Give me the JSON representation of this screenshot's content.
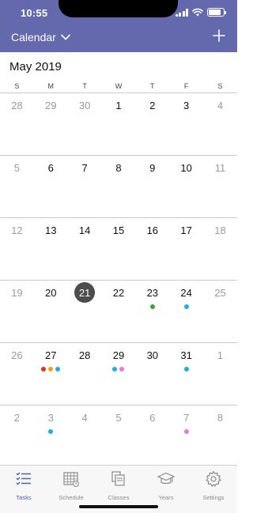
{
  "status": {
    "time": "10:55",
    "battery_level": 0.85
  },
  "nav": {
    "title": "Calendar"
  },
  "calendar": {
    "month": "May 2019",
    "weekdays": [
      "S",
      "M",
      "T",
      "W",
      "T",
      "F",
      "S"
    ],
    "weeks": [
      [
        {
          "d": "28",
          "muted": true
        },
        {
          "d": "29",
          "muted": true
        },
        {
          "d": "30",
          "muted": true
        },
        {
          "d": "1"
        },
        {
          "d": "2"
        },
        {
          "d": "3"
        },
        {
          "d": "4",
          "muted": true
        }
      ],
      [
        {
          "d": "5",
          "muted": true
        },
        {
          "d": "6"
        },
        {
          "d": "7"
        },
        {
          "d": "8"
        },
        {
          "d": "9"
        },
        {
          "d": "10"
        },
        {
          "d": "11",
          "muted": true
        }
      ],
      [
        {
          "d": "12",
          "muted": true
        },
        {
          "d": "13"
        },
        {
          "d": "14"
        },
        {
          "d": "15"
        },
        {
          "d": "16"
        },
        {
          "d": "17"
        },
        {
          "d": "18",
          "muted": true
        }
      ],
      [
        {
          "d": "19",
          "muted": true
        },
        {
          "d": "20"
        },
        {
          "d": "21",
          "today": true
        },
        {
          "d": "22"
        },
        {
          "d": "23",
          "dots": [
            "#3aa53a"
          ]
        },
        {
          "d": "24",
          "dots": [
            "#1ab0e0"
          ]
        },
        {
          "d": "25",
          "muted": true
        }
      ],
      [
        {
          "d": "26",
          "muted": true
        },
        {
          "d": "27",
          "dots": [
            "#d23a1e",
            "#f5a01a",
            "#1ab0e0"
          ]
        },
        {
          "d": "28"
        },
        {
          "d": "29",
          "dots": [
            "#1ab0e0",
            "#e27cd6"
          ]
        },
        {
          "d": "30"
        },
        {
          "d": "31",
          "dots": [
            "#1ab0e0"
          ]
        },
        {
          "d": "1",
          "muted": true
        }
      ],
      [
        {
          "d": "2",
          "muted": true
        },
        {
          "d": "3",
          "muted": true,
          "dots": [
            "#1ab0e0"
          ]
        },
        {
          "d": "4",
          "muted": true
        },
        {
          "d": "5",
          "muted": true
        },
        {
          "d": "6",
          "muted": true
        },
        {
          "d": "7",
          "muted": true,
          "dots": [
            "#e27cd6"
          ]
        },
        {
          "d": "8",
          "muted": true
        }
      ]
    ]
  },
  "tabs": [
    {
      "label": "Tasks",
      "icon": "tasks-icon",
      "active": true
    },
    {
      "label": "Schedule",
      "icon": "schedule-icon"
    },
    {
      "label": "Classes",
      "icon": "classes-icon"
    },
    {
      "label": "Years",
      "icon": "years-icon"
    },
    {
      "label": "Settings",
      "icon": "settings-icon"
    }
  ],
  "colors": {
    "header": "#6468ac",
    "active_tab": "#4e62b3",
    "inactive_tab": "#8a8a8a",
    "today": "#4d4d4d"
  }
}
